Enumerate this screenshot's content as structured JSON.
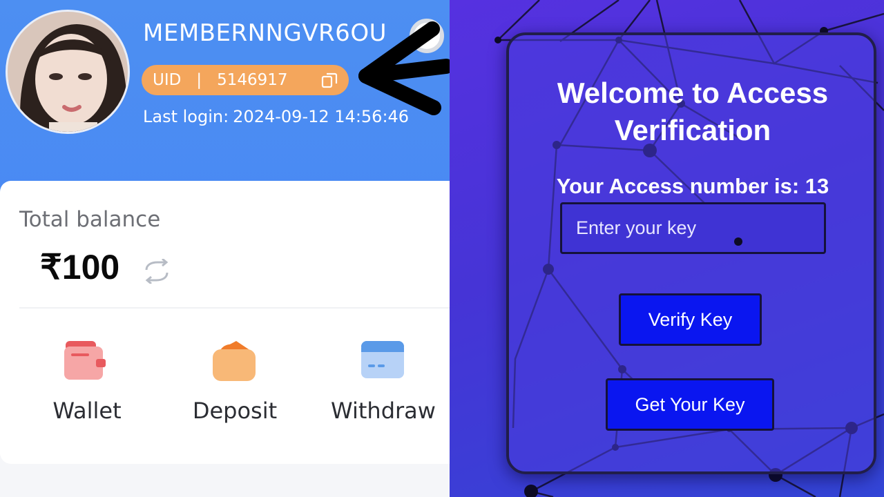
{
  "profile": {
    "username": "MEMBERNNGVR6OU",
    "uid_label": "UID",
    "uid_separator": "|",
    "uid_value": "5146917",
    "last_login_label": "Last login:",
    "last_login_value": "2024-09-12 14:56:46"
  },
  "balance": {
    "label": "Total balance",
    "amount": "₹100"
  },
  "actions": [
    {
      "label": "Wallet",
      "icon": "wallet-icon"
    },
    {
      "label": "Deposit",
      "icon": "deposit-icon"
    },
    {
      "label": "Withdraw",
      "icon": "withdraw-icon"
    }
  ],
  "verification": {
    "title_line1": "Welcome to Access",
    "title_line2": "Verification",
    "access_text": "Your Access number is: 13",
    "key_placeholder": "Enter your key",
    "verify_button": "Verify Key",
    "get_key_button": "Get Your Key"
  },
  "colors": {
    "header_blue": "#4a8af3",
    "uid_pill_orange": "#f4a65c",
    "verify_bg": "#4634d6",
    "button_blue": "#0a16f0"
  }
}
